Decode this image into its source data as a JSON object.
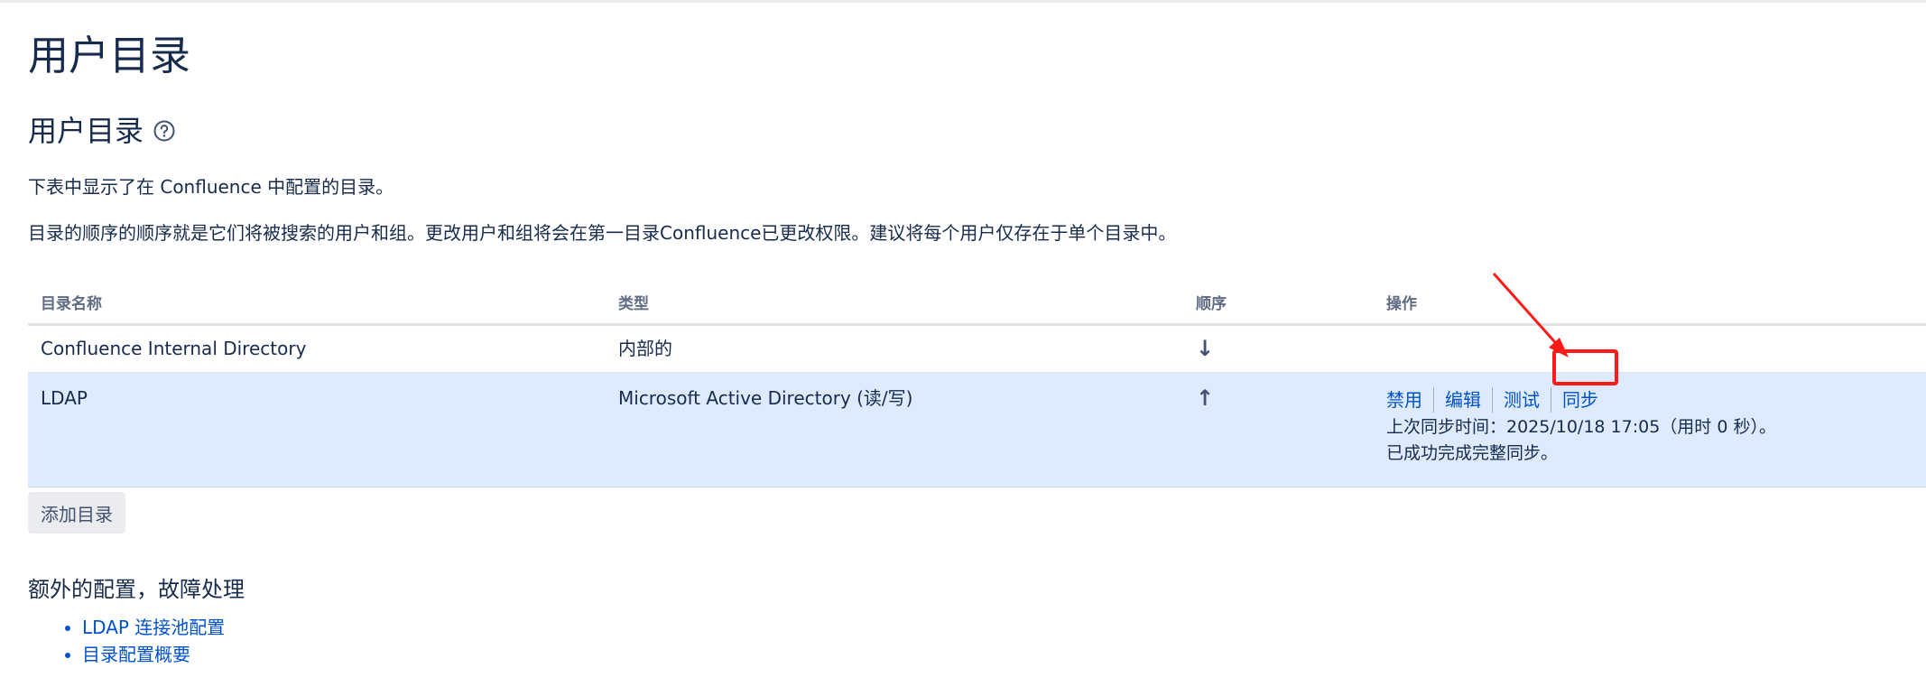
{
  "page_title": "用户目录",
  "section_title": "用户目录",
  "description_1": "下表中显示了在 Confluence 中配置的目录。",
  "description_2": "目录的顺序的顺序就是它们将被搜索的用户和组。更改用户和组将会在第一目录Confluence已更改权限。建议将每个用户仅存在于单个目录中。",
  "table": {
    "headers": {
      "name": "目录名称",
      "type": "类型",
      "order": "顺序",
      "actions": "操作"
    },
    "rows": [
      {
        "name": "Confluence Internal Directory",
        "type": "内部的",
        "order_icon": "arrow-down-icon",
        "order_glyph": "↓"
      },
      {
        "name": "LDAP",
        "type": "Microsoft Active Directory (读/写)",
        "order_icon": "arrow-up-icon",
        "order_glyph": "↑",
        "actions": [
          "禁用",
          "编辑",
          "测试",
          "同步"
        ],
        "status_line_1": "上次同步时间：2025/10/18 17:05（用时 0 秒）。",
        "status_line_2": "已成功完成完整同步。"
      }
    ]
  },
  "add_directory_label": "添加目录",
  "extra_title": "额外的配置，故障处理",
  "extra_links": [
    "LDAP 连接池配置",
    "目录配置概要"
  ],
  "colors": {
    "link": "#0052cc",
    "highlight_row": "#deebff",
    "annotation": "#ff1a1a"
  }
}
